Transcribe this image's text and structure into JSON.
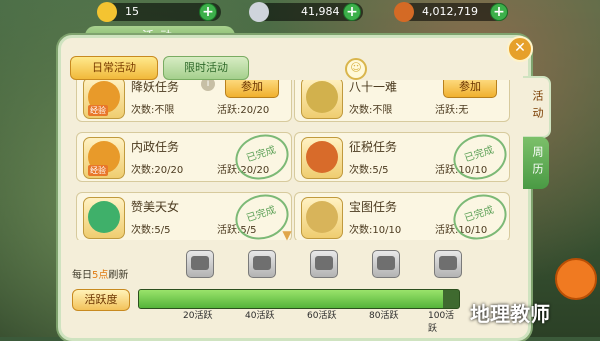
{
  "currencies": [
    {
      "icon": "gold-ingot-icon",
      "value": "15",
      "color": "#f4c431"
    },
    {
      "icon": "silver-ingot-icon",
      "value": "41,984",
      "color": "#cfd4dc"
    },
    {
      "icon": "copper-coin-icon",
      "value": "4,012,719",
      "color": "#d46a25"
    }
  ],
  "panel": {
    "title": "活动",
    "close_label": "✕"
  },
  "tabs": [
    {
      "label": "日常活动"
    },
    {
      "label": "限时活动"
    }
  ],
  "side_tabs": [
    {
      "label": "活动"
    },
    {
      "label": "周历"
    }
  ],
  "tasks": [
    {
      "name": "降妖任务",
      "count": "次数:不限",
      "activity": "活跃:20/20",
      "icon": "exp-bag-icon",
      "tag": "经验",
      "action": "参加",
      "info": "i",
      "completed": false
    },
    {
      "name": "八十一难",
      "count": "次数:不限",
      "activity": "活跃:无",
      "icon": "golden-staff-icon",
      "tag": "",
      "action": "参加",
      "info": "",
      "completed": false
    },
    {
      "name": "内政任务",
      "count": "次数:20/20",
      "activity": "活跃:20/20",
      "icon": "exp-bag-icon",
      "tag": "经验",
      "action": "",
      "info": "",
      "completed": true
    },
    {
      "name": "征税任务",
      "count": "次数:5/5",
      "activity": "活跃:10/10",
      "icon": "coins-icon",
      "tag": "",
      "action": "",
      "info": "",
      "completed": true
    },
    {
      "name": "赞美天女",
      "count": "次数:5/5",
      "activity": "活跃:5/5",
      "icon": "green-bag-icon",
      "tag": "",
      "action": "",
      "info": "",
      "completed": true
    },
    {
      "name": "宝图任务",
      "count": "次数:10/10",
      "activity": "活跃:10/10",
      "icon": "treasure-map-icon",
      "tag": "",
      "action": "",
      "info": "",
      "completed": true
    }
  ],
  "completed_stamp": "已完成",
  "refresh": {
    "prefix": "每日",
    "hour": "5点",
    "suffix": "刷新"
  },
  "activity_label": "活跃度",
  "progress": {
    "value": 0.95
  },
  "milestones": [
    "20活跃",
    "40活跃",
    "60活跃",
    "80活跃",
    "100活跃"
  ],
  "watermark": "地理教师"
}
